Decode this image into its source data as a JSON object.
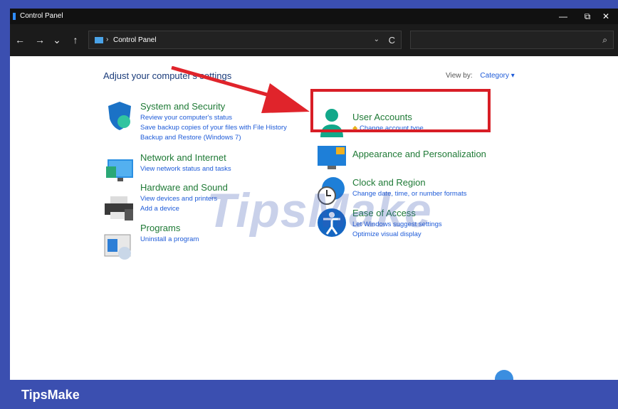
{
  "window": {
    "title": "Control Panel",
    "min": "—",
    "max": "⧉",
    "close": "✕"
  },
  "nav": {
    "back": "←",
    "forward": "→",
    "recent": "⌄",
    "up": "↑",
    "path_sep": "›",
    "path": "Control Panel",
    "dropdown": "⌄",
    "refresh": "C",
    "search_icon": "⌕"
  },
  "content": {
    "heading": "Adjust your computer's settings",
    "view_by_label": "View by:",
    "view_by_value": "Category ▾",
    "left": [
      {
        "title": "System and Security",
        "links": [
          "Review your computer's status",
          "Save backup copies of your files with File History",
          "Backup and Restore (Windows 7)"
        ],
        "icon": "shield-icon"
      },
      {
        "title": "Network and Internet",
        "links": [
          "View network status and tasks"
        ],
        "icon": "network-icon"
      },
      {
        "title": "Hardware and Sound",
        "links": [
          "View devices and printers",
          "Add a device"
        ],
        "icon": "printer-icon"
      },
      {
        "title": "Programs",
        "links": [
          "Uninstall a program"
        ],
        "icon": "programs-icon"
      }
    ],
    "right": [
      {
        "title": "User Accounts",
        "links": [
          "Change account type"
        ],
        "icon": "user-icon"
      },
      {
        "title": "Appearance and Personalization",
        "links": [],
        "icon": "monitor-icon"
      },
      {
        "title": "Clock and Region",
        "links": [
          "Change date, time, or number formats"
        ],
        "icon": "clock-icon"
      },
      {
        "title": "Ease of Access",
        "links": [
          "Let Windows suggest settings",
          "Optimize visual display"
        ],
        "icon": "accessibility-icon"
      }
    ]
  },
  "watermark": "TipsMake",
  "banner": {
    "brand": "TipsMake"
  },
  "colors": {
    "accent_red": "#d81e26",
    "banner": "#3b4fb0",
    "link": "#1e5bd8",
    "category": "#1f7a36"
  }
}
